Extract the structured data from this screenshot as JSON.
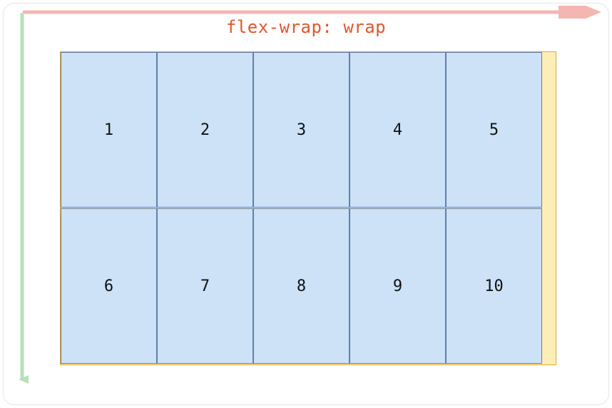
{
  "title": "flex-wrap: wrap",
  "colors": {
    "accent_text": "#e1552a",
    "container_bg": "#fdeeb5",
    "container_border": "#e0a838",
    "item_bg": "#cde2f7",
    "item_border": "#5f7fb0",
    "horizontal_arrow": "#f4b6b0",
    "vertical_arrow": "#b7e0b7"
  },
  "flex": {
    "property": "flex-wrap",
    "value": "wrap",
    "items": [
      "1",
      "2",
      "3",
      "4",
      "5",
      "6",
      "7",
      "8",
      "9",
      "10"
    ]
  }
}
